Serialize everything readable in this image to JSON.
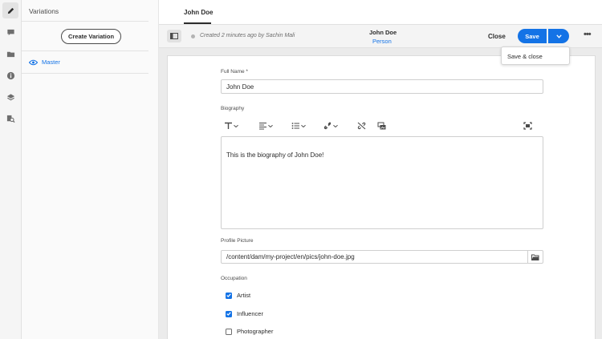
{
  "rail": {
    "icons": [
      "pencil-icon",
      "comment-icon",
      "folder-icon",
      "info-icon",
      "layers-icon",
      "search-references-icon"
    ]
  },
  "variations_panel": {
    "title": "Variations",
    "create_button": "Create Variation",
    "master_label": "Master"
  },
  "tabs": [
    "John Doe"
  ],
  "action_bar": {
    "status": "Created 2 minutes ago by Sachin Mali",
    "doc_title": "John Doe",
    "doc_type": "Person",
    "close_label": "Close",
    "save_label": "Save",
    "more_label": "•••",
    "save_menu": [
      "Save & close"
    ]
  },
  "form": {
    "full_name": {
      "label": "Full Name *",
      "value": "John Doe"
    },
    "biography": {
      "label": "Biography",
      "content": "This is the biography of John Doe!",
      "toolbar": [
        "text-format-icon",
        "align-icon",
        "list-icon",
        "link-icon",
        "unlink-icon",
        "image-icon",
        "fullscreen-icon"
      ]
    },
    "profile_picture": {
      "label": "Profile Picture",
      "value": "/content/dam/my-project/en/pics/john-doe.jpg"
    },
    "occupation": {
      "label": "Occupation",
      "options": [
        {
          "label": "Artist",
          "checked": true
        },
        {
          "label": "Influencer",
          "checked": true
        },
        {
          "label": "Photographer",
          "checked": false
        }
      ]
    }
  },
  "colors": {
    "accent": "#1473e6",
    "text": "#2c2c2c",
    "muted": "#6e6e6e"
  }
}
